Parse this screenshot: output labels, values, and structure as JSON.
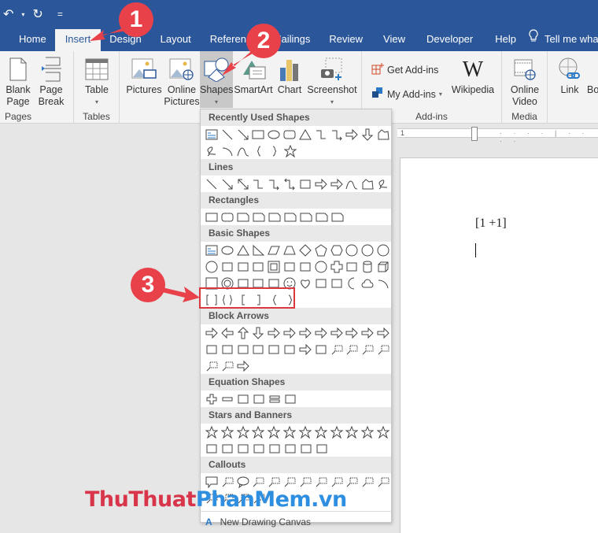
{
  "quick_access": {
    "undo_icon": "↶",
    "redo_icon": "↻",
    "customize_icon": "="
  },
  "tabs": [
    {
      "label": "Home"
    },
    {
      "label": "Insert",
      "active": true
    },
    {
      "label": "Design"
    },
    {
      "label": "Layout"
    },
    {
      "label": "References"
    },
    {
      "label": "Mailings"
    },
    {
      "label": "Review"
    },
    {
      "label": "View"
    },
    {
      "label": "Developer"
    },
    {
      "label": "Help"
    }
  ],
  "tell_me": "Tell me what",
  "ribbon": {
    "pages": {
      "label": "Pages",
      "blank_page": [
        "Blank",
        "Page"
      ],
      "page_break": [
        "Page",
        "Break"
      ]
    },
    "tables": {
      "label": "Tables",
      "table": "Table"
    },
    "illustrations": {
      "pictures": "Pictures",
      "online_pictures": [
        "Online",
        "Pictures"
      ],
      "shapes": "Shapes",
      "smartart": "SmartArt",
      "chart": "Chart",
      "screenshot": "Screenshot"
    },
    "addins": {
      "label": "Add-ins",
      "get_addins": "Get Add-ins",
      "my_addins": "My Add-ins",
      "wikipedia": "Wikipedia",
      "wikipedia_glyph": "W"
    },
    "media": {
      "label": "Media",
      "online_video": [
        "Online",
        "Video"
      ]
    },
    "links": {
      "link": "Link",
      "bookmark": "Bo"
    }
  },
  "ruler": {
    "mark": "1"
  },
  "document": {
    "text": "[1 +1]"
  },
  "shapes_menu": {
    "sections": [
      {
        "title": "Recently Used Shapes",
        "rows": [
          [
            "textbox",
            "line",
            "arrow-line",
            "rectangle",
            "oval",
            "rounded-rect",
            "triangle",
            "elbow",
            "elbow-arrow",
            "right-arrow",
            "down-arrow",
            "freeform"
          ],
          [
            "scribble",
            "arc",
            "curve",
            "left-brace",
            "right-brace",
            "star5"
          ]
        ]
      },
      {
        "title": "Lines",
        "rows": [
          [
            "line",
            "arrow-line",
            "double-arrow",
            "elbow",
            "elbow-arrow",
            "elbow-double-arrow",
            "curve-connector",
            "curve-arrow",
            "curve-double-arrow",
            "curve",
            "freeform",
            "scribble"
          ]
        ]
      },
      {
        "title": "Rectangles",
        "rows": [
          [
            "rectangle",
            "rounded-rect",
            "snip-single",
            "snip-same",
            "snip-diag",
            "snip-round",
            "round-single",
            "round-same",
            "round-diag"
          ]
        ]
      },
      {
        "title": "Basic Shapes",
        "rows": [
          [
            "textbox",
            "oval",
            "triangle",
            "right-triangle",
            "parallelogram",
            "trapezoid",
            "diamond",
            "pentagon",
            "hexagon",
            "heptagon",
            "octagon",
            "decagon"
          ],
          [
            "dodecagon",
            "pie",
            "chord",
            "teardrop",
            "frame",
            "half-frame",
            "l-shape",
            "diagonal-stripe",
            "cross",
            "plaque",
            "can",
            "cube"
          ],
          [
            "bevel",
            "donut",
            "no-symbol",
            "block-arc",
            "folded-corner",
            "smiley",
            "heart",
            "lightning",
            "sun",
            "moon",
            "cloud",
            "arc"
          ],
          [
            "double-bracket",
            "double-brace",
            "left-bracket",
            "right-bracket",
            "left-brace",
            "right-brace"
          ]
        ]
      },
      {
        "title": "Block Arrows",
        "rows": [
          [
            "right-arrow",
            "left-arrow",
            "up-arrow",
            "down-arrow",
            "left-right-arrow",
            "up-down-arrow",
            "quad-arrow",
            "left-right-up-arrow",
            "bent-arrow",
            "u-turn-arrow",
            "left-up-arrow",
            "bent-up-arrow"
          ],
          [
            "curved-right",
            "curved-left",
            "curved-up",
            "curved-down",
            "striped-right",
            "notched-right",
            "pentagon-arrow",
            "chevron",
            "right-callout",
            "down-callout",
            "left-callout",
            "up-callout"
          ],
          [
            "left-right-callout",
            "quad-callout",
            "circular-arrow"
          ]
        ]
      },
      {
        "title": "Equation Shapes",
        "rows": [
          [
            "plus",
            "minus",
            "multiply",
            "divide",
            "equal",
            "not-equal"
          ]
        ]
      },
      {
        "title": "Stars and Banners",
        "rows": [
          [
            "explosion1",
            "explosion2",
            "star4",
            "star5",
            "star6",
            "star7",
            "star8",
            "star10",
            "star12",
            "star16",
            "star24",
            "star32"
          ],
          [
            "ribbon-up",
            "ribbon-down",
            "curved-ribbon-up",
            "curved-ribbon-down",
            "vertical-scroll",
            "horizontal-scroll",
            "wave",
            "double-wave"
          ]
        ]
      },
      {
        "title": "Callouts",
        "rows": [
          [
            "rect-callout",
            "round-rect-callout",
            "oval-callout",
            "cloud-callout",
            "line-callout1",
            "line-callout2",
            "line-callout3",
            "line-callout1-accent",
            "line-callout2-accent",
            "line-callout3-accent",
            "line-callout1-noborder",
            "line-callout2-noborder"
          ],
          [
            "line-callout3-noborder",
            "line-callout1-border-accent",
            "line-callout2-border-accent",
            "line-callout3-border-accent"
          ]
        ]
      }
    ],
    "new_canvas": "New Drawing Canvas"
  },
  "annotations": {
    "step1": "1",
    "step2": "2",
    "step3": "3",
    "highlight_color": "#d9393e",
    "badge_color": "#e8414a"
  },
  "watermark": {
    "part1": "ThuThuat",
    "part2": "PhanMem",
    "part3": ".vn"
  }
}
